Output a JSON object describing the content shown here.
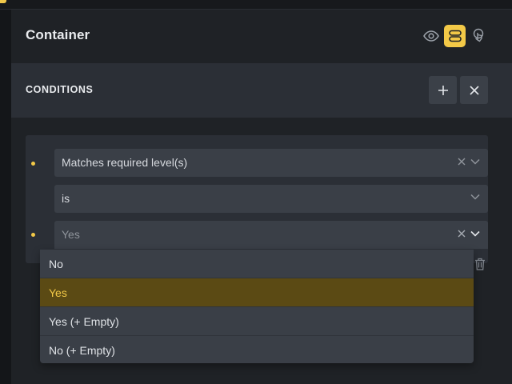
{
  "panel": {
    "title": "Container"
  },
  "header_icons": [
    {
      "name": "eye-icon"
    },
    {
      "name": "conditions-toggle-icon",
      "active": true,
      "color": "#f3c947"
    },
    {
      "name": "interaction-icon"
    }
  ],
  "conditions": {
    "title": "CONDITIONS",
    "add_icon": "plus-icon",
    "close_icon": "x-icon"
  },
  "condition": {
    "field_value": "Matches required level(s)",
    "operator_value": "is",
    "value_placeholder": "Yes"
  },
  "dropdown": {
    "options": [
      {
        "label": "No",
        "selected": false
      },
      {
        "label": "Yes",
        "selected": true
      },
      {
        "label": "Yes (+ Empty)",
        "selected": false
      },
      {
        "label": "No (+ Empty)",
        "selected": false
      }
    ]
  },
  "colors": {
    "accent": "#f3c947",
    "selected_bg": "#5b4a14"
  }
}
